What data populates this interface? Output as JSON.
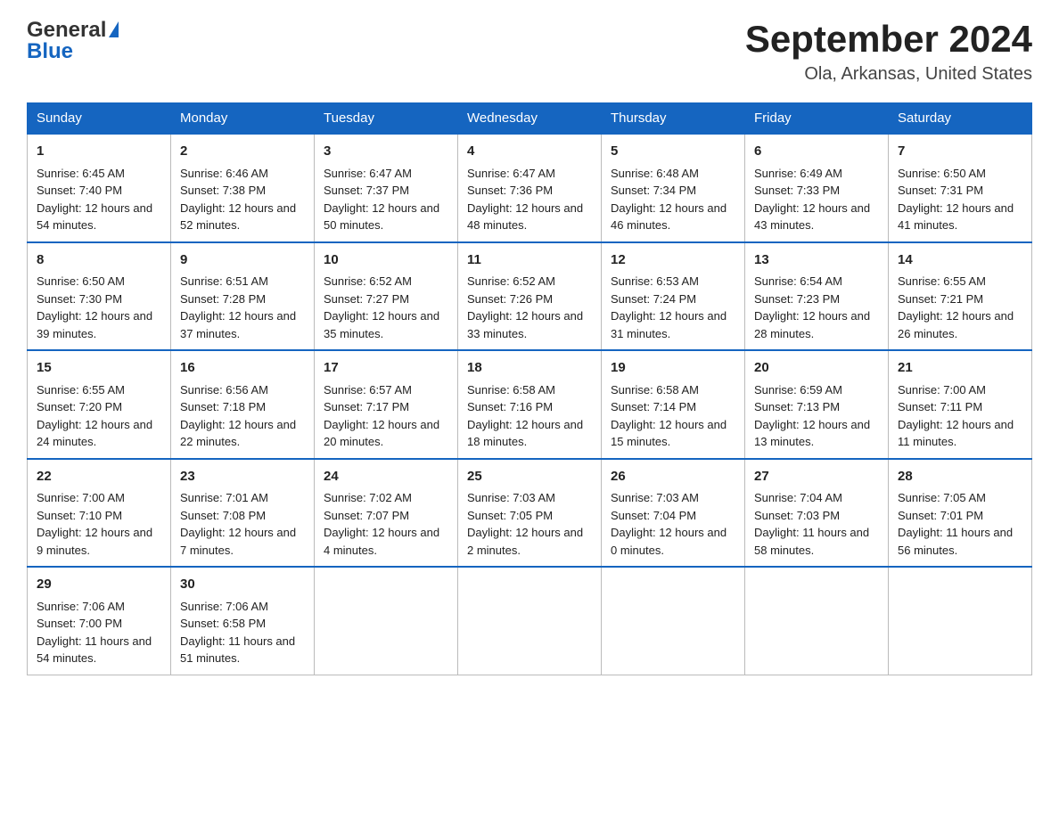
{
  "header": {
    "logo_general": "General",
    "logo_blue": "Blue",
    "month_title": "September 2024",
    "location": "Ola, Arkansas, United States"
  },
  "days_of_week": [
    "Sunday",
    "Monday",
    "Tuesday",
    "Wednesday",
    "Thursday",
    "Friday",
    "Saturday"
  ],
  "weeks": [
    [
      {
        "day": "1",
        "sunrise": "Sunrise: 6:45 AM",
        "sunset": "Sunset: 7:40 PM",
        "daylight": "Daylight: 12 hours and 54 minutes."
      },
      {
        "day": "2",
        "sunrise": "Sunrise: 6:46 AM",
        "sunset": "Sunset: 7:38 PM",
        "daylight": "Daylight: 12 hours and 52 minutes."
      },
      {
        "day": "3",
        "sunrise": "Sunrise: 6:47 AM",
        "sunset": "Sunset: 7:37 PM",
        "daylight": "Daylight: 12 hours and 50 minutes."
      },
      {
        "day": "4",
        "sunrise": "Sunrise: 6:47 AM",
        "sunset": "Sunset: 7:36 PM",
        "daylight": "Daylight: 12 hours and 48 minutes."
      },
      {
        "day": "5",
        "sunrise": "Sunrise: 6:48 AM",
        "sunset": "Sunset: 7:34 PM",
        "daylight": "Daylight: 12 hours and 46 minutes."
      },
      {
        "day": "6",
        "sunrise": "Sunrise: 6:49 AM",
        "sunset": "Sunset: 7:33 PM",
        "daylight": "Daylight: 12 hours and 43 minutes."
      },
      {
        "day": "7",
        "sunrise": "Sunrise: 6:50 AM",
        "sunset": "Sunset: 7:31 PM",
        "daylight": "Daylight: 12 hours and 41 minutes."
      }
    ],
    [
      {
        "day": "8",
        "sunrise": "Sunrise: 6:50 AM",
        "sunset": "Sunset: 7:30 PM",
        "daylight": "Daylight: 12 hours and 39 minutes."
      },
      {
        "day": "9",
        "sunrise": "Sunrise: 6:51 AM",
        "sunset": "Sunset: 7:28 PM",
        "daylight": "Daylight: 12 hours and 37 minutes."
      },
      {
        "day": "10",
        "sunrise": "Sunrise: 6:52 AM",
        "sunset": "Sunset: 7:27 PM",
        "daylight": "Daylight: 12 hours and 35 minutes."
      },
      {
        "day": "11",
        "sunrise": "Sunrise: 6:52 AM",
        "sunset": "Sunset: 7:26 PM",
        "daylight": "Daylight: 12 hours and 33 minutes."
      },
      {
        "day": "12",
        "sunrise": "Sunrise: 6:53 AM",
        "sunset": "Sunset: 7:24 PM",
        "daylight": "Daylight: 12 hours and 31 minutes."
      },
      {
        "day": "13",
        "sunrise": "Sunrise: 6:54 AM",
        "sunset": "Sunset: 7:23 PM",
        "daylight": "Daylight: 12 hours and 28 minutes."
      },
      {
        "day": "14",
        "sunrise": "Sunrise: 6:55 AM",
        "sunset": "Sunset: 7:21 PM",
        "daylight": "Daylight: 12 hours and 26 minutes."
      }
    ],
    [
      {
        "day": "15",
        "sunrise": "Sunrise: 6:55 AM",
        "sunset": "Sunset: 7:20 PM",
        "daylight": "Daylight: 12 hours and 24 minutes."
      },
      {
        "day": "16",
        "sunrise": "Sunrise: 6:56 AM",
        "sunset": "Sunset: 7:18 PM",
        "daylight": "Daylight: 12 hours and 22 minutes."
      },
      {
        "day": "17",
        "sunrise": "Sunrise: 6:57 AM",
        "sunset": "Sunset: 7:17 PM",
        "daylight": "Daylight: 12 hours and 20 minutes."
      },
      {
        "day": "18",
        "sunrise": "Sunrise: 6:58 AM",
        "sunset": "Sunset: 7:16 PM",
        "daylight": "Daylight: 12 hours and 18 minutes."
      },
      {
        "day": "19",
        "sunrise": "Sunrise: 6:58 AM",
        "sunset": "Sunset: 7:14 PM",
        "daylight": "Daylight: 12 hours and 15 minutes."
      },
      {
        "day": "20",
        "sunrise": "Sunrise: 6:59 AM",
        "sunset": "Sunset: 7:13 PM",
        "daylight": "Daylight: 12 hours and 13 minutes."
      },
      {
        "day": "21",
        "sunrise": "Sunrise: 7:00 AM",
        "sunset": "Sunset: 7:11 PM",
        "daylight": "Daylight: 12 hours and 11 minutes."
      }
    ],
    [
      {
        "day": "22",
        "sunrise": "Sunrise: 7:00 AM",
        "sunset": "Sunset: 7:10 PM",
        "daylight": "Daylight: 12 hours and 9 minutes."
      },
      {
        "day": "23",
        "sunrise": "Sunrise: 7:01 AM",
        "sunset": "Sunset: 7:08 PM",
        "daylight": "Daylight: 12 hours and 7 minutes."
      },
      {
        "day": "24",
        "sunrise": "Sunrise: 7:02 AM",
        "sunset": "Sunset: 7:07 PM",
        "daylight": "Daylight: 12 hours and 4 minutes."
      },
      {
        "day": "25",
        "sunrise": "Sunrise: 7:03 AM",
        "sunset": "Sunset: 7:05 PM",
        "daylight": "Daylight: 12 hours and 2 minutes."
      },
      {
        "day": "26",
        "sunrise": "Sunrise: 7:03 AM",
        "sunset": "Sunset: 7:04 PM",
        "daylight": "Daylight: 12 hours and 0 minutes."
      },
      {
        "day": "27",
        "sunrise": "Sunrise: 7:04 AM",
        "sunset": "Sunset: 7:03 PM",
        "daylight": "Daylight: 11 hours and 58 minutes."
      },
      {
        "day": "28",
        "sunrise": "Sunrise: 7:05 AM",
        "sunset": "Sunset: 7:01 PM",
        "daylight": "Daylight: 11 hours and 56 minutes."
      }
    ],
    [
      {
        "day": "29",
        "sunrise": "Sunrise: 7:06 AM",
        "sunset": "Sunset: 7:00 PM",
        "daylight": "Daylight: 11 hours and 54 minutes."
      },
      {
        "day": "30",
        "sunrise": "Sunrise: 7:06 AM",
        "sunset": "Sunset: 6:58 PM",
        "daylight": "Daylight: 11 hours and 51 minutes."
      },
      null,
      null,
      null,
      null,
      null
    ]
  ]
}
